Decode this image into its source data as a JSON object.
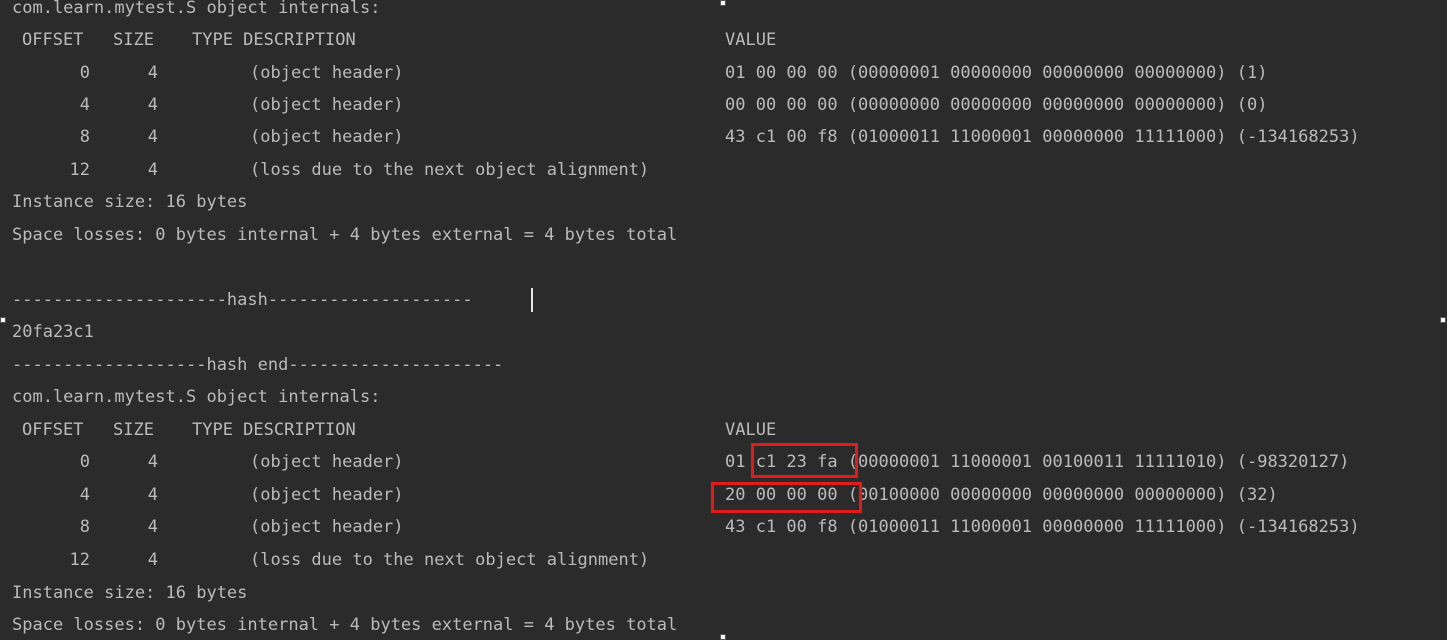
{
  "colors": {
    "background": "#2b2b2b",
    "text": "#bbbbbb",
    "highlight_border": "#e21b1b"
  },
  "block1": {
    "title": "com.learn.mytest.S object internals:",
    "headers": {
      "offset": "OFFSET",
      "size": "SIZE",
      "type_description": "TYPE DESCRIPTION",
      "value": "VALUE"
    },
    "rows": [
      {
        "offset": "0",
        "size": "4",
        "description": "(object header)",
        "value": "01 00 00 00 (00000001 00000000 00000000 00000000) (1)"
      },
      {
        "offset": "4",
        "size": "4",
        "description": "(object header)",
        "value": "00 00 00 00 (00000000 00000000 00000000 00000000) (0)"
      },
      {
        "offset": "8",
        "size": "4",
        "description": "(object header)",
        "value": "43 c1 00 f8 (01000011 11000001 00000000 11111000) (-134168253)"
      },
      {
        "offset": "12",
        "size": "4",
        "description": "(loss due to the next object alignment)",
        "value": ""
      }
    ],
    "instance_size": "Instance size: 16 bytes",
    "space_losses": "Space losses: 0 bytes internal + 4 bytes external = 4 bytes total"
  },
  "hash_section": {
    "start_line": "---------------------hash--------------------",
    "hash_value": "20fa23c1",
    "end_line": "-------------------hash end---------------------"
  },
  "block2": {
    "title": "com.learn.mytest.S object internals:",
    "headers": {
      "offset": "OFFSET",
      "size": "SIZE",
      "type_description": "TYPE DESCRIPTION",
      "value": "VALUE"
    },
    "rows": [
      {
        "offset": "0",
        "size": "4",
        "description": "(object header)",
        "value": "01 c1 23 fa (00000001 11000001 00100011 11111010) (-98320127)"
      },
      {
        "offset": "4",
        "size": "4",
        "description": "(object header)",
        "value": "20 00 00 00 (00100000 00000000 00000000 00000000) (32)"
      },
      {
        "offset": "8",
        "size": "4",
        "description": "(object header)",
        "value": "43 c1 00 f8 (01000011 11000001 00000000 11111000) (-134168253)"
      },
      {
        "offset": "12",
        "size": "4",
        "description": "(loss due to the next object alignment)",
        "value": ""
      }
    ],
    "instance_size": "Instance size: 16 bytes",
    "space_losses": "Space losses: 0 bytes internal + 4 bytes external = 4 bytes total"
  }
}
